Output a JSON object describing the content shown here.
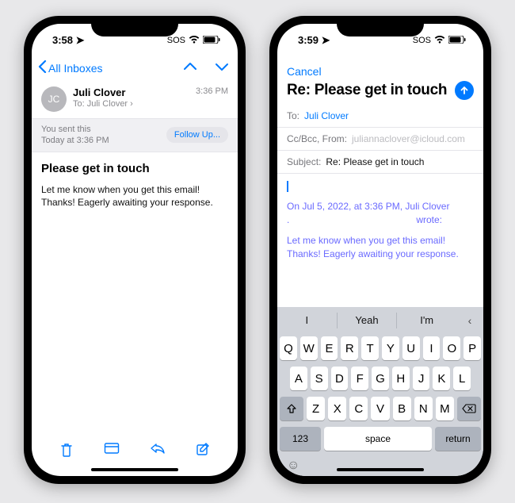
{
  "left": {
    "status_time": "3:58",
    "status_sos": "SOS",
    "back_label": "All Inboxes",
    "avatar_initials": "JC",
    "from_name": "Juli Clover",
    "to_label": "To:",
    "to_name": "Juli Clover",
    "time": "3:36 PM",
    "sent_line1": "You sent this",
    "sent_line2": "Today at 3:36 PM",
    "follow_up": "Follow Up...",
    "subject": "Please get in touch",
    "body": "Let me know when you get this email! Thanks! Eagerly awaiting your response."
  },
  "right": {
    "status_time": "3:59",
    "status_sos": "SOS",
    "cancel": "Cancel",
    "title": "Re: Please get in touch",
    "to_label": "To:",
    "to_value": "Juli Clover",
    "ccbcc_label": "Cc/Bcc, From:",
    "ccbcc_value": "juliannaclover@icloud.com",
    "subject_label": "Subject:",
    "subject_value": "Re: Please get in touch",
    "quoted_header": "On Jul 5, 2022, at 3:36 PM, Juli Clover",
    "quoted_dot": ".",
    "quoted_wrote": "wrote:",
    "quoted_body": "Let me know when you get this email! Thanks! Eagerly awaiting your response."
  },
  "keyboard": {
    "predict1": "I",
    "predict2": "Yeah",
    "predict3": "I'm",
    "row1": [
      "Q",
      "W",
      "E",
      "R",
      "T",
      "Y",
      "U",
      "I",
      "O",
      "P"
    ],
    "row2": [
      "A",
      "S",
      "D",
      "F",
      "G",
      "H",
      "J",
      "K",
      "L"
    ],
    "row3": [
      "Z",
      "X",
      "C",
      "V",
      "B",
      "N",
      "M"
    ],
    "numbers": "123",
    "space": "space",
    "return": "return"
  }
}
